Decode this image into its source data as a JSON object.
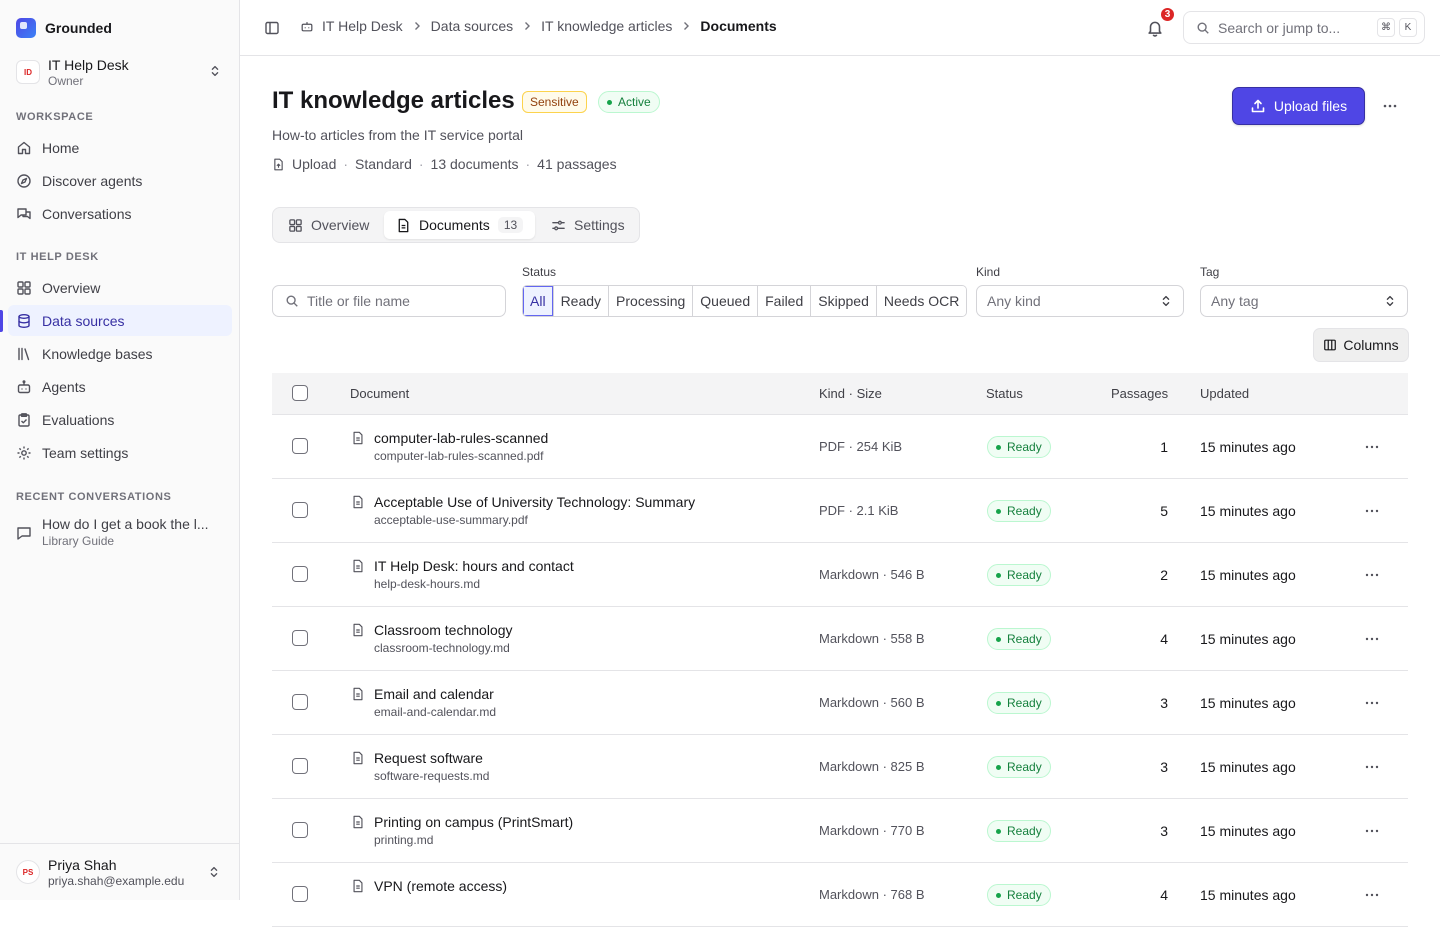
{
  "app": {
    "name": "Grounded"
  },
  "workspace": {
    "initials": "ID",
    "name": "IT Help Desk",
    "role": "Owner"
  },
  "sidebar": {
    "workspace_label": "WORKSPACE",
    "workspace_items": [
      {
        "label": "Home",
        "icon": "home-icon"
      },
      {
        "label": "Discover agents",
        "icon": "compass-icon"
      },
      {
        "label": "Conversations",
        "icon": "chat-icon"
      }
    ],
    "helpdesk_label": "IT HELP DESK",
    "helpdesk_items": [
      {
        "label": "Overview",
        "icon": "grid-icon"
      },
      {
        "label": "Data sources",
        "icon": "database-icon",
        "active": true
      },
      {
        "label": "Knowledge bases",
        "icon": "library-icon"
      },
      {
        "label": "Agents",
        "icon": "bot-icon"
      },
      {
        "label": "Evaluations",
        "icon": "clipboard-icon"
      },
      {
        "label": "Team settings",
        "icon": "gear-icon"
      }
    ],
    "recent_label": "RECENT CONVERSATIONS",
    "recent": [
      {
        "title": "How do I get a book the l...",
        "subtitle": "Library Guide"
      }
    ]
  },
  "user": {
    "initials": "PS",
    "name": "Priya Shah",
    "email": "priya.shah@example.edu"
  },
  "topbar": {
    "breadcrumbs": [
      "IT Help Desk",
      "Data sources",
      "IT knowledge articles",
      "Documents"
    ],
    "notifications": "3",
    "search_placeholder": "Search or jump to...",
    "shortcut_keys": [
      "⌘",
      "K"
    ]
  },
  "header": {
    "title": "IT knowledge articles",
    "badge_sensitive": "Sensitive",
    "badge_status": "Active",
    "subtitle": "How-to articles from the IT service portal",
    "meta": [
      "Upload",
      "Standard",
      "13 documents",
      "41 passages"
    ],
    "upload_label": "Upload files"
  },
  "tabs": [
    {
      "label": "Overview",
      "icon": "grid-icon"
    },
    {
      "label": "Documents",
      "icon": "document-icon",
      "count": "13",
      "active": true
    },
    {
      "label": "Settings",
      "icon": "sliders-icon"
    }
  ],
  "filters": {
    "search_placeholder": "Title or file name",
    "status_label": "Status",
    "status_options": [
      "All",
      "Ready",
      "Processing",
      "Queued",
      "Failed",
      "Skipped",
      "Needs OCR"
    ],
    "status_selected": "All",
    "kind_label": "Kind",
    "kind_value": "Any kind",
    "tag_label": "Tag",
    "tag_value": "Any tag",
    "columns_label": "Columns"
  },
  "table": {
    "columns": [
      "Document",
      "Kind · Size",
      "Status",
      "Passages",
      "Updated"
    ],
    "rows": [
      {
        "title": "computer-lab-rules-scanned",
        "file": "computer-lab-rules-scanned.pdf",
        "kind": "PDF · 254 KiB",
        "status": "Ready",
        "passages": "1",
        "updated": "15 minutes ago"
      },
      {
        "title": "Acceptable Use of University Technology: Summary",
        "file": "acceptable-use-summary.pdf",
        "kind": "PDF · 2.1 KiB",
        "status": "Ready",
        "passages": "5",
        "updated": "15 minutes ago"
      },
      {
        "title": "IT Help Desk: hours and contact",
        "file": "help-desk-hours.md",
        "kind": "Markdown · 546 B",
        "status": "Ready",
        "passages": "2",
        "updated": "15 minutes ago"
      },
      {
        "title": "Classroom technology",
        "file": "classroom-technology.md",
        "kind": "Markdown · 558 B",
        "status": "Ready",
        "passages": "4",
        "updated": "15 minutes ago"
      },
      {
        "title": "Email and calendar",
        "file": "email-and-calendar.md",
        "kind": "Markdown · 560 B",
        "status": "Ready",
        "passages": "3",
        "updated": "15 minutes ago"
      },
      {
        "title": "Request software",
        "file": "software-requests.md",
        "kind": "Markdown · 825 B",
        "status": "Ready",
        "passages": "3",
        "updated": "15 minutes ago"
      },
      {
        "title": "Printing on campus (PrintSmart)",
        "file": "printing.md",
        "kind": "Markdown · 770 B",
        "status": "Ready",
        "passages": "3",
        "updated": "15 minutes ago"
      },
      {
        "title": "VPN (remote access)",
        "file": "",
        "kind": "Markdown · 768 B",
        "status": "Ready",
        "passages": "4",
        "updated": "15 minutes ago"
      }
    ]
  },
  "colors": {
    "accent": "#4f46e5",
    "ready": "#15803d",
    "danger": "#dc2626"
  }
}
